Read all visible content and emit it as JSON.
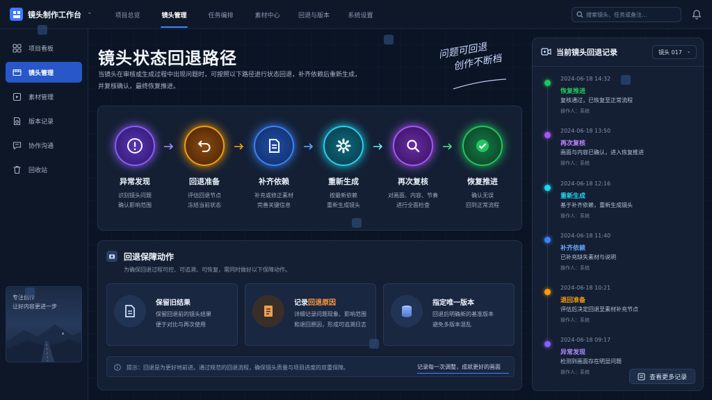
{
  "app": {
    "title": "镜头制作工作台"
  },
  "nav": {
    "tabs": [
      {
        "label": "项目总览",
        "active": false
      },
      {
        "label": "镜头管理",
        "active": true
      },
      {
        "label": "任务编排",
        "active": false
      },
      {
        "label": "素材中心",
        "active": false
      },
      {
        "label": "回退与版本",
        "active": false
      },
      {
        "label": "系统设置",
        "active": false
      }
    ],
    "search_placeholder": "搜索镜头、任务或备注..."
  },
  "sidebar": {
    "items": [
      {
        "label": "项目看板",
        "icon": "grid-icon",
        "active": false
      },
      {
        "label": "镜头管理",
        "icon": "film-icon",
        "active": true
      },
      {
        "label": "素材管理",
        "icon": "media-file-icon",
        "active": false
      },
      {
        "label": "版本记录",
        "icon": "history-file-icon",
        "active": false
      },
      {
        "label": "协作沟通",
        "icon": "chat-icon",
        "active": false
      },
      {
        "label": "回收站",
        "icon": "trash-icon",
        "active": false
      }
    ],
    "card": {
      "line1": "专注创作",
      "line2": "让好内容更进一步"
    }
  },
  "main": {
    "title": "镜头状态回退路径",
    "desc_line1": "当镜头在审核或生成过程中出现问题时，可按照以下路径进行状态回退，补齐依赖后重新生成，",
    "desc_line2": "并复核确认，最终恢复推进。",
    "slogan_line1": "问题可回退",
    "slogan_line2": "创作不断档"
  },
  "flow": {
    "steps": [
      {
        "name": "异常发现",
        "d1": "识别镜头问题",
        "d2": "确认影响范围",
        "color": "#8b5cf6",
        "icon": "alert-icon"
      },
      {
        "name": "回退准备",
        "d1": "评估回退节点",
        "d2": "冻结当前状态",
        "color": "#f59e0b",
        "icon": "undo-icon"
      },
      {
        "name": "补齐依赖",
        "d1": "补充或修正素材",
        "d2": "完善关键信息",
        "color": "#3b82f6",
        "icon": "document-icon"
      },
      {
        "name": "重新生成",
        "d1": "按最新依赖",
        "d2": "重新生成镜头",
        "color": "#22d3ee",
        "icon": "gear-icon"
      },
      {
        "name": "再次复核",
        "d1": "对画面、内容、节奏",
        "d2": "进行全面检查",
        "color": "#a855f7",
        "icon": "search-icon"
      },
      {
        "name": "恢复推进",
        "d1": "确认无误",
        "d2": "回到正常流程",
        "color": "#22c55e",
        "icon": "check-icon"
      }
    ]
  },
  "guard": {
    "title": "回退保障动作",
    "subtitle": "为确保回退过程可控、可追溯、可恢复，需同时做好以下保障动作。",
    "cards": [
      {
        "title": "保留旧结果",
        "title_highlight": "",
        "d1": "保留回退前的镜头结果",
        "d2": "便于对比与再次使用",
        "icon": "file-icon"
      },
      {
        "title": "记录",
        "title_highlight": "回退原因",
        "d1": "详细记录问题现象、影响范围",
        "d2": "和退回原因，形成可追溯日志",
        "icon": "log-icon"
      },
      {
        "title": "指定唯一版本",
        "title_highlight": "",
        "d1": "回退后明确新的基准版本",
        "d2": "避免多版本混乱",
        "icon": "database-icon"
      }
    ],
    "tip": "提示：回退是为更好地前进。通过规范的回退流程，确保镜头质量与项目进度的双重保障。",
    "tip_link": "记录每一次调整，成就更好的画面"
  },
  "records": {
    "title": "当前镜头回退记录",
    "selected": "镜头 017",
    "items": [
      {
        "time": "2024-06-18 14:32",
        "title": "恢复推进",
        "desc": "复核通过，已恢复至正常流程",
        "op": "操作人：系统",
        "color": "#22c55e"
      },
      {
        "time": "2024-06-18 13:50",
        "title": "再次复核",
        "desc": "画面与内容已确认，进入恢复推进",
        "op": "操作人：系统",
        "color": "#a855f7"
      },
      {
        "time": "2024-06-18 12:16",
        "title": "重新生成",
        "desc": "基于补齐依赖，重新生成镜头",
        "op": "操作人：系统",
        "color": "#22d3ee"
      },
      {
        "time": "2024-06-18 11:40",
        "title": "补齐依赖",
        "desc": "已补充缺失素材与说明",
        "op": "操作人：系统",
        "color": "#3b82f6"
      },
      {
        "time": "2024-06-18 10:21",
        "title": "退回准备",
        "desc": "评估后决定回退至素材补充节点",
        "op": "操作人：系统",
        "color": "#f59e0b"
      },
      {
        "time": "2024-06-18 09:17",
        "title": "异常发现",
        "desc": "检测到画面存在明显问题",
        "op": "操作人：系统",
        "color": "#8b5cf6"
      }
    ],
    "more_label": "查看更多记录"
  }
}
